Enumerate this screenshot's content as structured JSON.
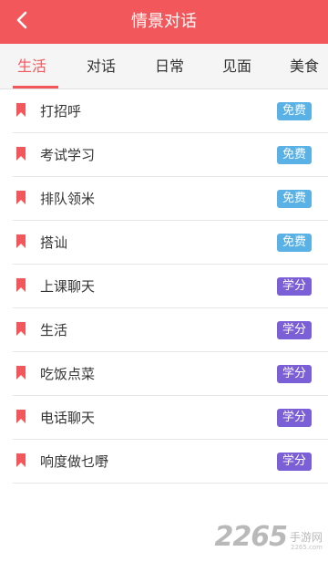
{
  "header": {
    "title": "情景对话",
    "back_icon": "chevron-left-icon"
  },
  "tabs": [
    {
      "label": "生活",
      "active": true
    },
    {
      "label": "对话",
      "active": false
    },
    {
      "label": "日常",
      "active": false
    },
    {
      "label": "见面",
      "active": false
    },
    {
      "label": "美食",
      "active": false
    }
  ],
  "list": {
    "bookmark_icon": "bookmark-icon",
    "items": [
      {
        "label": "打招呼",
        "badge": "免费"
      },
      {
        "label": "考试学习",
        "badge": "免费"
      },
      {
        "label": "排队领米",
        "badge": "免费"
      },
      {
        "label": "搭讪",
        "badge": "免费"
      },
      {
        "label": "上课聊天",
        "badge": "学分"
      },
      {
        "label": "生活",
        "badge": "学分"
      },
      {
        "label": "吃饭点菜",
        "badge": "学分"
      },
      {
        "label": "电话聊天",
        "badge": "学分"
      },
      {
        "label": "响度做乜嘢",
        "badge": "学分"
      }
    ]
  },
  "watermark": {
    "number": "2265",
    "text": "手游网",
    "sub": "2265.com"
  },
  "colors": {
    "accent": "#f2575b",
    "free_badge": "#5ab1e6",
    "credit_badge": "#7a5fd6"
  }
}
